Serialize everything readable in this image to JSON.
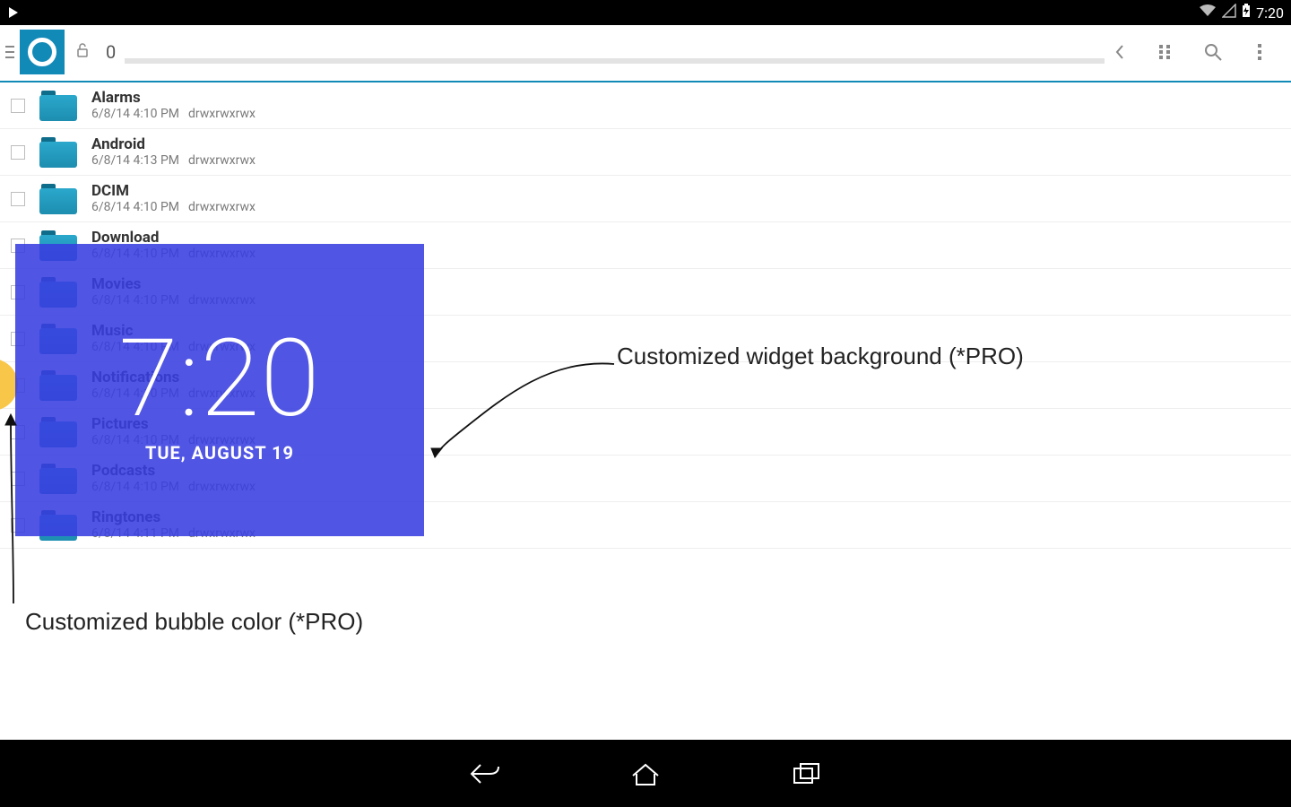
{
  "status": {
    "time": "7:20"
  },
  "toolbar": {
    "path_label": "0"
  },
  "files": [
    {
      "name": "Alarms",
      "date": "6/8/14 4:10 PM",
      "perm": "drwxrwxrwx"
    },
    {
      "name": "Android",
      "date": "6/8/14 4:13 PM",
      "perm": "drwxrwxrwx"
    },
    {
      "name": "DCIM",
      "date": "6/8/14 4:10 PM",
      "perm": "drwxrwxrwx"
    },
    {
      "name": "Download",
      "date": "6/8/14 4:10 PM",
      "perm": "drwxrwxrwx"
    },
    {
      "name": "Movies",
      "date": "6/8/14 4:10 PM",
      "perm": "drwxrwxrwx"
    },
    {
      "name": "Music",
      "date": "6/8/14 4:10 PM",
      "perm": "drwxrwxrwx"
    },
    {
      "name": "Notifications",
      "date": "6/8/14 4:10 PM",
      "perm": "drwxrwxrwx"
    },
    {
      "name": "Pictures",
      "date": "6/8/14 4:10 PM",
      "perm": "drwxrwxrwx"
    },
    {
      "name": "Podcasts",
      "date": "6/8/14 4:10 PM",
      "perm": "drwxrwxrwx"
    },
    {
      "name": "Ringtones",
      "date": "6/8/14 4:11 PM",
      "perm": "drwxrwxrwx"
    }
  ],
  "widget": {
    "time": "7:20",
    "date": "TUE, AUGUST 19"
  },
  "annotations": {
    "bg": "Customized widget background (*PRO)",
    "bubble": "Customized bubble color (*PRO)"
  }
}
